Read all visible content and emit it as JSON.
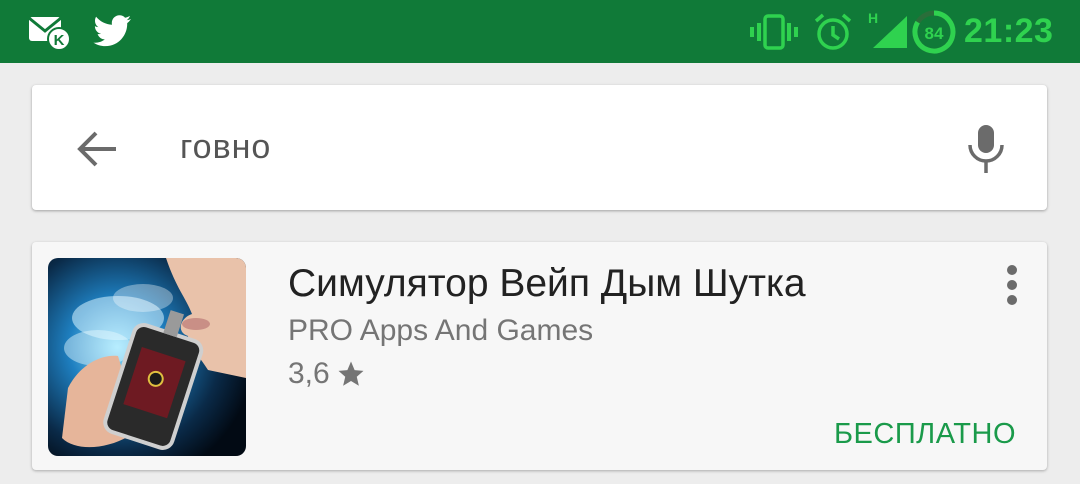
{
  "status_bar": {
    "time": "21:23",
    "battery_percent": "84",
    "network_type": "H",
    "icons": [
      "mail-icon",
      "twitter-icon",
      "vibrate-icon",
      "alarm-icon",
      "signal-icon",
      "battery-icon"
    ],
    "colors": {
      "background": "#107a38",
      "accent": "#2fd24f"
    }
  },
  "search": {
    "query": "говно",
    "back_icon": "arrow-back-icon",
    "mic_icon": "microphone-icon"
  },
  "results": [
    {
      "title": "Симулятор Вейп Дым Шутка",
      "developer": "PRO Apps And Games",
      "rating": "3,6",
      "rating_icon": "star-icon",
      "price": "БЕСПЛАТНО",
      "menu_icon": "more-vert-icon",
      "price_color": "#1a9a4a"
    }
  ]
}
